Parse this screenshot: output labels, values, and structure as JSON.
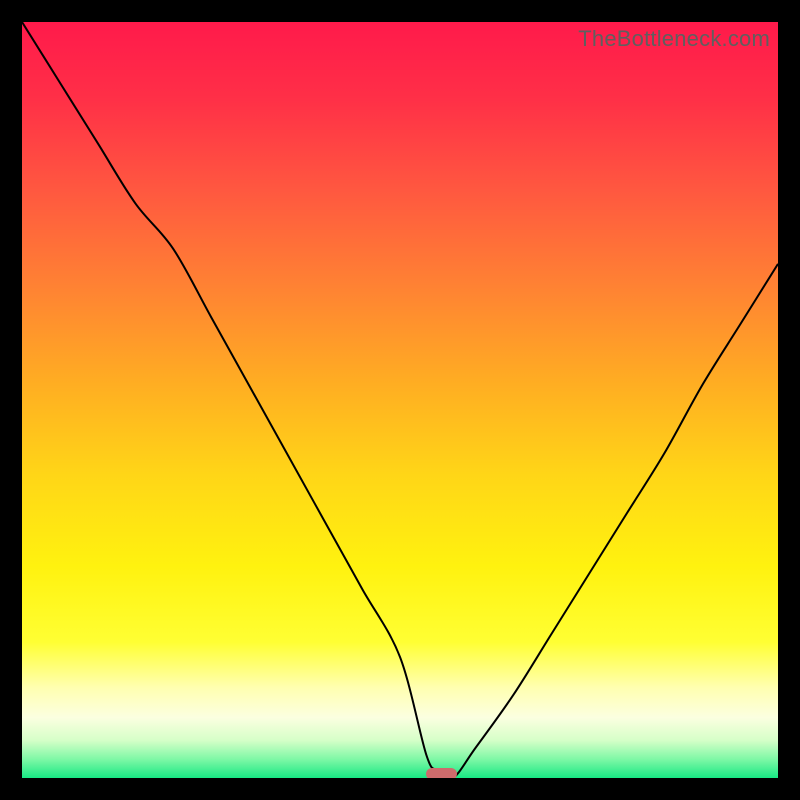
{
  "watermark": "TheBottleneck.com",
  "colors": {
    "frame": "#000000",
    "watermark": "#5f5f5f",
    "curve": "#000000",
    "marker": "#ce6b6c",
    "gradient_stops": [
      {
        "offset": 0.0,
        "color": "#ff1a4b"
      },
      {
        "offset": 0.1,
        "color": "#ff2f47"
      },
      {
        "offset": 0.22,
        "color": "#ff5740"
      },
      {
        "offset": 0.35,
        "color": "#ff8233"
      },
      {
        "offset": 0.48,
        "color": "#ffae22"
      },
      {
        "offset": 0.6,
        "color": "#ffd617"
      },
      {
        "offset": 0.72,
        "color": "#fff20f"
      },
      {
        "offset": 0.82,
        "color": "#ffff33"
      },
      {
        "offset": 0.88,
        "color": "#ffffb0"
      },
      {
        "offset": 0.92,
        "color": "#fbffe0"
      },
      {
        "offset": 0.95,
        "color": "#d6ffc8"
      },
      {
        "offset": 0.975,
        "color": "#7ff8a6"
      },
      {
        "offset": 1.0,
        "color": "#18e884"
      }
    ]
  },
  "chart_data": {
    "type": "line",
    "title": "",
    "xlabel": "",
    "ylabel": "",
    "xlim": [
      0,
      100
    ],
    "ylim": [
      0,
      100
    ],
    "grid": false,
    "legend_position": "none",
    "annotations": [
      "TheBottleneck.com"
    ],
    "series": [
      {
        "name": "bottleneck-curve",
        "x": [
          0,
          5,
          10,
          15,
          20,
          25,
          30,
          35,
          40,
          45,
          50,
          53.5,
          55,
          57,
          60,
          65,
          70,
          75,
          80,
          85,
          90,
          95,
          100
        ],
        "y": [
          100,
          92,
          84,
          76,
          70,
          61,
          52,
          43,
          34,
          25,
          16,
          3,
          1,
          0,
          4,
          11,
          19,
          27,
          35,
          43,
          52,
          60,
          68
        ]
      }
    ],
    "marker": {
      "x_start": 53.5,
      "x_end": 57.5,
      "y": 0
    }
  }
}
